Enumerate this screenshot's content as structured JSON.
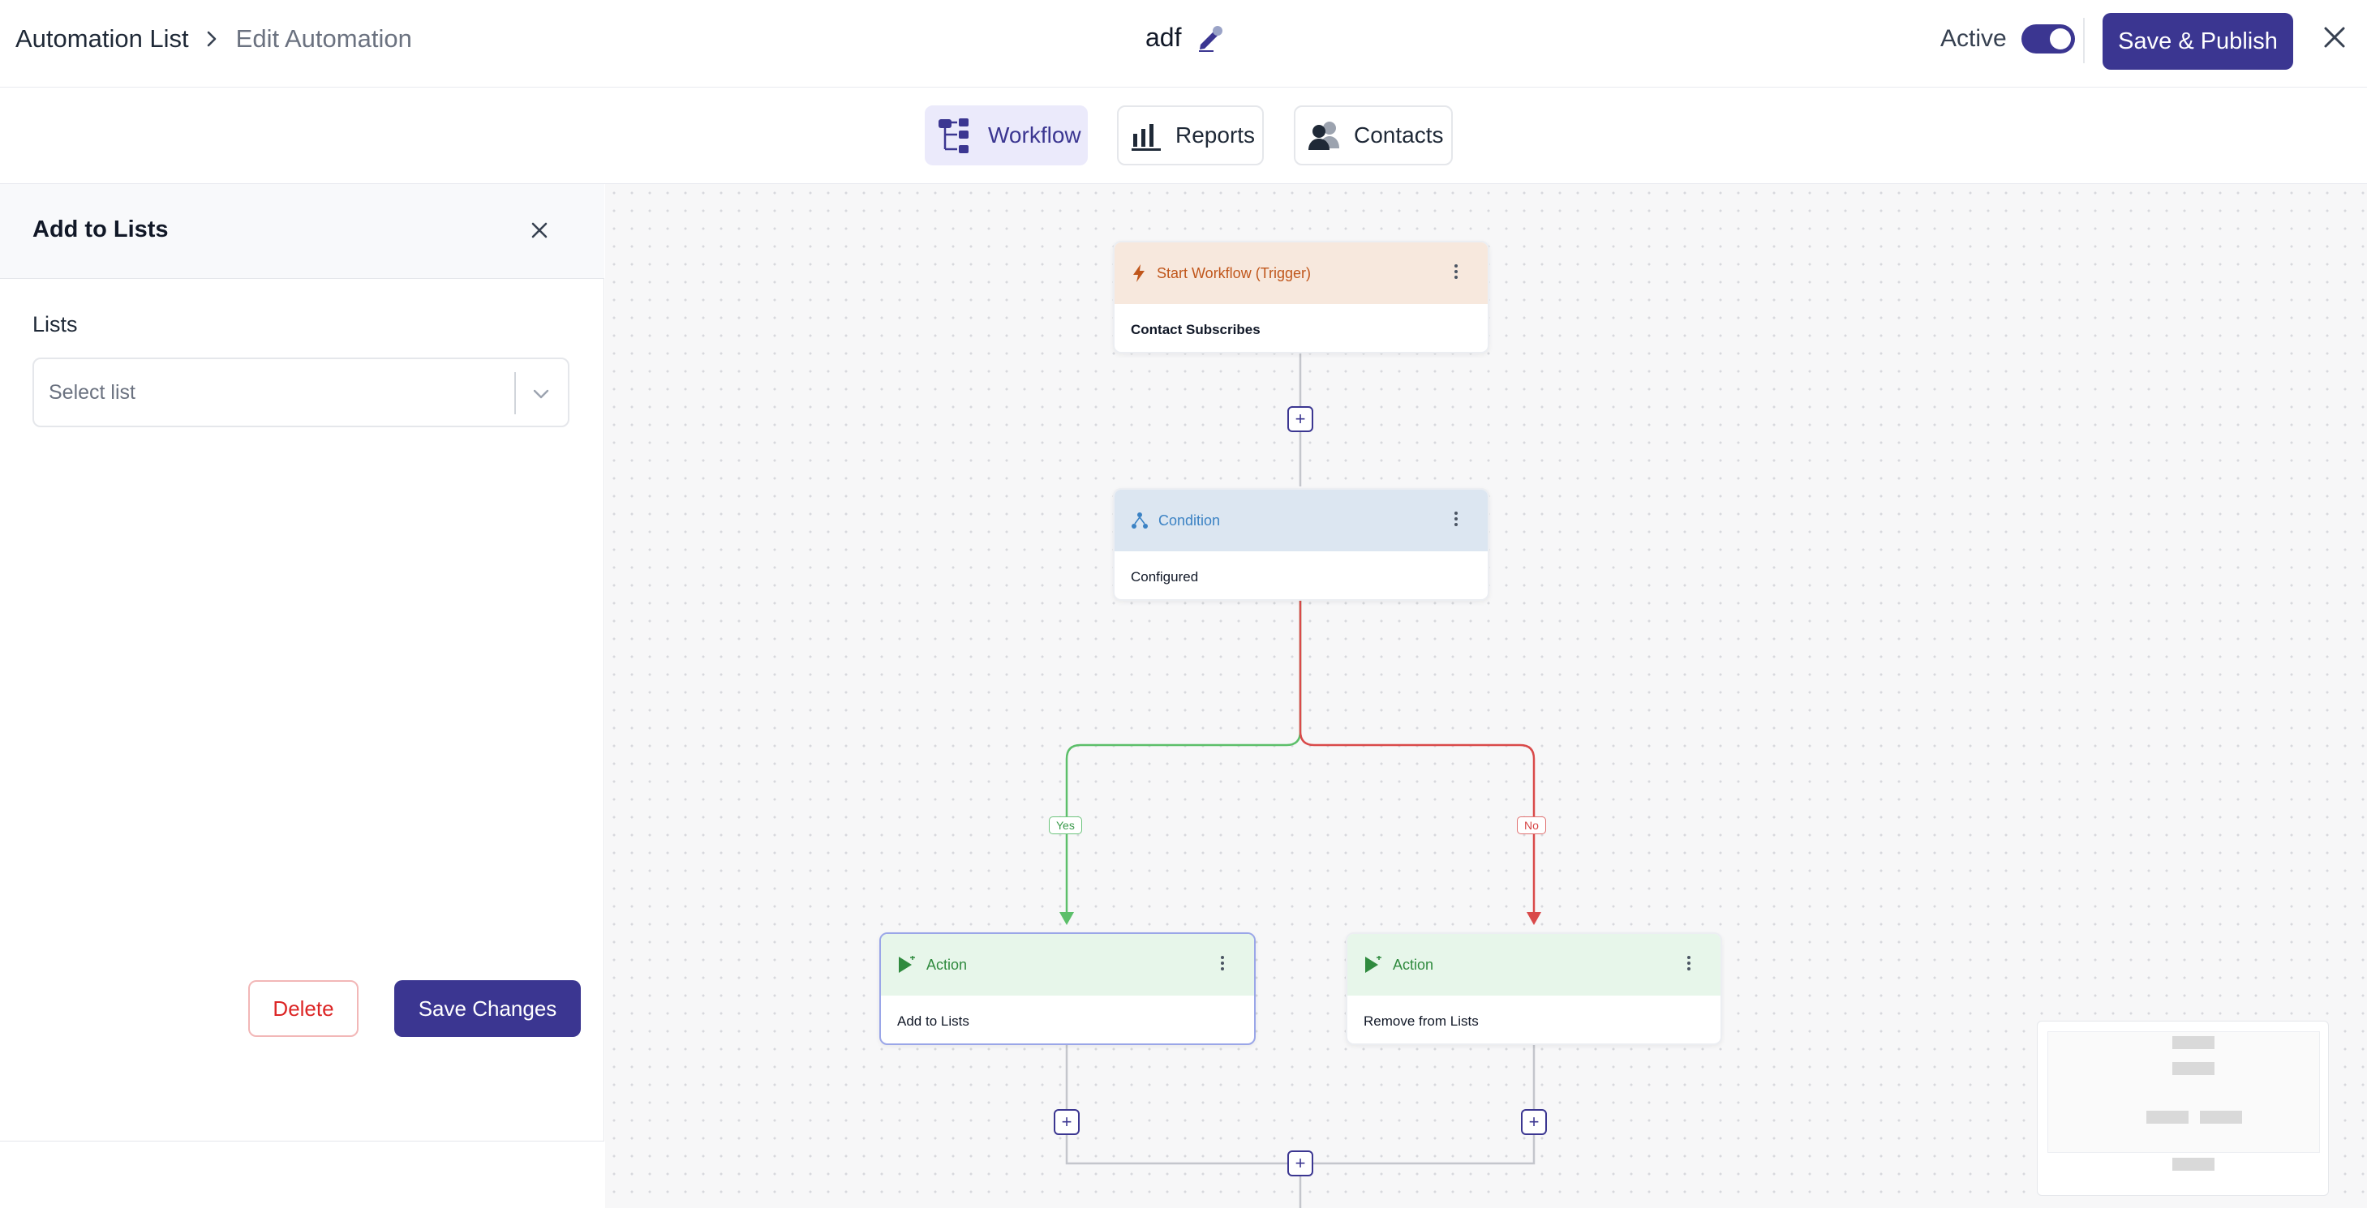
{
  "header": {
    "breadcrumb_root": "Automation List",
    "breadcrumb_current": "Edit Automation",
    "title": "adf",
    "active_label": "Active",
    "active_on": true,
    "publish_label": "Save & Publish"
  },
  "tabs": [
    {
      "label": "Workflow",
      "active": true
    },
    {
      "label": "Reports",
      "active": false
    },
    {
      "label": "Contacts",
      "active": false
    }
  ],
  "panel": {
    "title": "Add to Lists",
    "field_label": "Lists",
    "select_placeholder": "Select list",
    "delete_label": "Delete",
    "save_label": "Save Changes"
  },
  "workflow": {
    "trigger": {
      "type": "Start Workflow (Trigger)",
      "body": "Contact Subscribes"
    },
    "condition": {
      "type": "Condition",
      "body": "Configured"
    },
    "yes_label": "Yes",
    "no_label": "No",
    "actions": [
      {
        "type": "Action",
        "body": "Add to Lists",
        "selected": true
      },
      {
        "type": "Action",
        "body": "Remove from Lists",
        "selected": false
      }
    ],
    "plus_symbol": "+"
  },
  "colors": {
    "primary": "#3b3691",
    "yes_branch": "#5cbf6a",
    "no_branch": "#d94a4a",
    "delete": "#dc2626"
  }
}
